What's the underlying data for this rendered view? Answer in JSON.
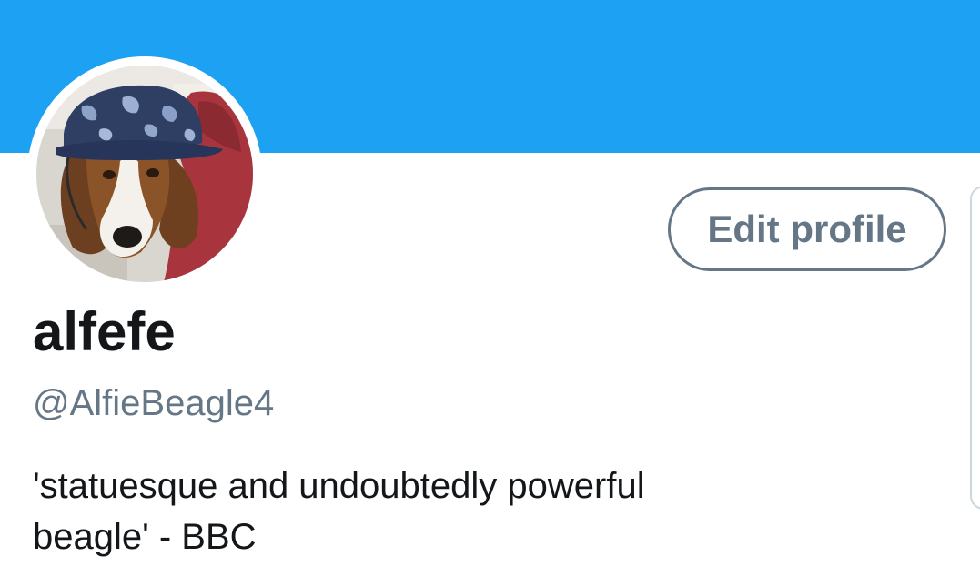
{
  "colors": {
    "banner": "#1da1f2",
    "name": "#14171a",
    "secondary": "#657786",
    "border": "#ccd6dd"
  },
  "profile": {
    "display_name": "alfefe",
    "handle": "@AlfieBeagle4",
    "bio_lines": [
      "'statuesque and undoubtedly powerful",
      "beagle' - BBC"
    ]
  },
  "actions": {
    "edit_profile_label": "Edit profile"
  },
  "icons": {
    "avatar": "beagle-avatar"
  }
}
